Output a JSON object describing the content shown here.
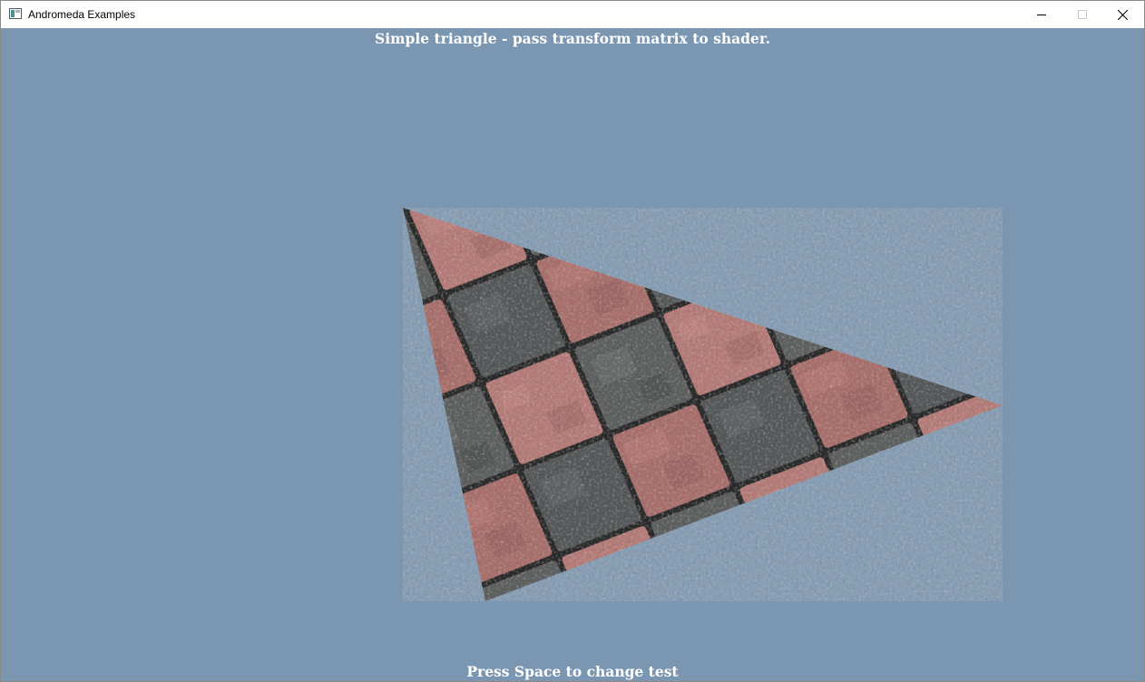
{
  "window": {
    "title": "Andromeda Examples",
    "controls": {
      "minimize_icon": "minimize-icon",
      "maximize_icon": "maximize-icon",
      "close_icon": "close-icon"
    }
  },
  "viewport": {
    "background_color": "#7b96b1",
    "heading": "Simple triangle - pass transform matrix to shader.",
    "footer_hint": "Press Space to change test",
    "shape": "textured-triangle",
    "texture": "paving-stones"
  }
}
